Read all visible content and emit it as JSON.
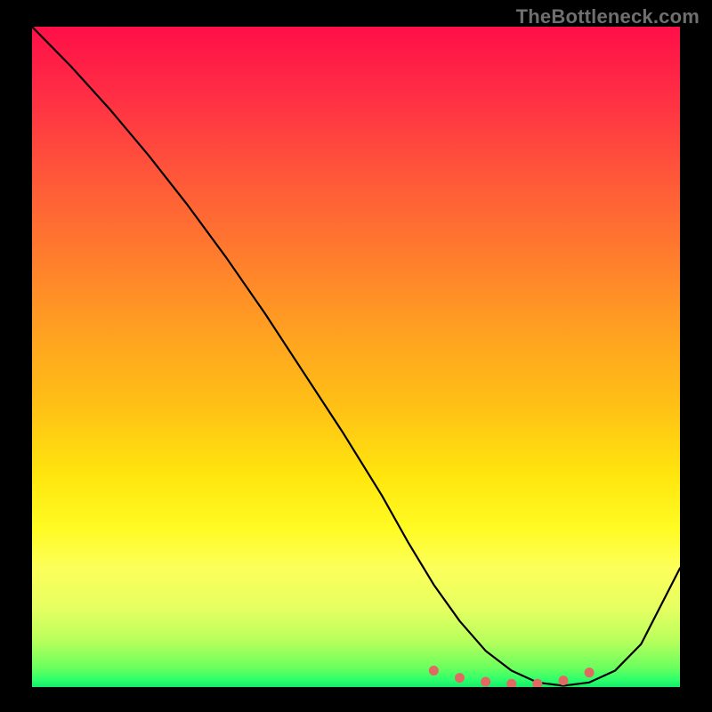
{
  "watermark": "TheBottleneck.com",
  "chart_data": {
    "type": "line",
    "title": "",
    "xlabel": "",
    "ylabel": "",
    "xlim": [
      0,
      100
    ],
    "ylim": [
      0,
      100
    ],
    "grid": false,
    "legend": false,
    "series": [
      {
        "name": "curve",
        "x": [
          0,
          6,
          12,
          18,
          24,
          30,
          36,
          42,
          48,
          54,
          58,
          62,
          66,
          70,
          74,
          78,
          82,
          86,
          90,
          94,
          100
        ],
        "values": [
          100,
          94,
          87.5,
          80.5,
          73,
          65,
          56.5,
          47.5,
          38.5,
          29,
          22,
          15.5,
          10,
          5.5,
          2.5,
          0.7,
          0.2,
          0.7,
          2.5,
          6.5,
          18
        ]
      }
    ],
    "markers": {
      "name": "red-dots",
      "x": [
        62,
        66,
        70,
        74,
        78,
        82,
        86
      ],
      "values": [
        2.5,
        1.4,
        0.8,
        0.5,
        0.5,
        1.0,
        2.2
      ],
      "color": "#e06a62"
    },
    "background_gradient": {
      "top": "#ff0f48",
      "upper_mid": "#ff7a2e",
      "mid": "#ffe60e",
      "lower_mid": "#b8ff5c",
      "bottom": "#17e86b"
    }
  }
}
